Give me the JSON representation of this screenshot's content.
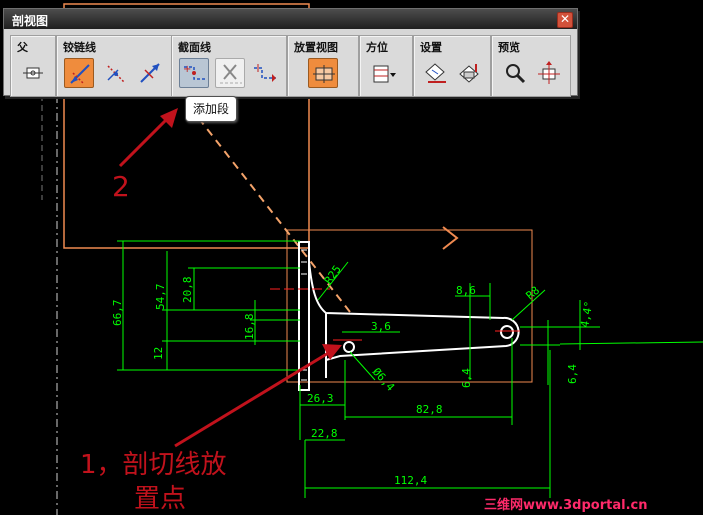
{
  "window": {
    "title": "剖视图",
    "close_label": "✕"
  },
  "groups": [
    {
      "label": "父",
      "buttons": [
        "parent-view-icon"
      ]
    },
    {
      "label": "铰链线",
      "buttons": [
        "auto-hinge-icon",
        "define-hinge-icon",
        "reverse-vector-icon"
      ]
    },
    {
      "label": "截面线",
      "buttons": [
        "add-segment-icon",
        "delete-segment-icon",
        "move-segment-icon"
      ]
    },
    {
      "label": "放置视图",
      "buttons": [
        "place-view-icon"
      ]
    },
    {
      "label": "方位",
      "buttons": [
        "orientation-icon"
      ]
    },
    {
      "label": "设置",
      "buttons": [
        "style-settings-icon",
        "view-settings-icon"
      ]
    },
    {
      "label": "预览",
      "buttons": [
        "preview-icon",
        "move-preview-icon"
      ]
    }
  ],
  "tooltip": "添加段",
  "dimensions": {
    "d66_7": "66,7",
    "d54_7": "54,7",
    "d20_8": "20,8",
    "d16_8": "16,8",
    "d12": "12",
    "r25": "R25",
    "d8_6": "8,6",
    "r8": "R8",
    "d3_6": "3,6",
    "a4_4": "4,4°",
    "d6_4a": "6,4",
    "d6_4b": "6,4",
    "phi6_4": "Ø6,4",
    "d26_3": "26,3",
    "d82_8": "82,8",
    "d22_8": "22,8",
    "d112_4": "112,4"
  },
  "annotations": {
    "step2": "2",
    "step1_line1": "1，剖切线放",
    "step1_line2": "置点"
  },
  "watermark": "三维网www.3dportal.cn",
  "colors": {
    "dimension": "#00ff00",
    "geometry": "#ffffff",
    "border": "#f08a50",
    "annotation": "#c1121c"
  }
}
